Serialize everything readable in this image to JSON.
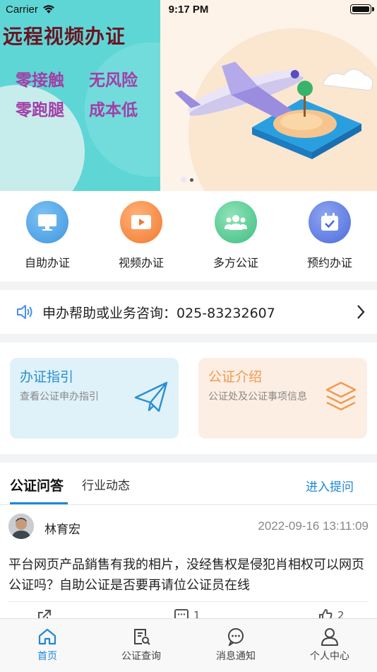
{
  "status_bar": {
    "carrier": "Carrier",
    "time": "9:17 PM"
  },
  "banner": {
    "title": "远程视频办证",
    "slogans": [
      "零接触",
      "无风险",
      "零跑腿",
      "成本低"
    ],
    "page_count": 2,
    "active_page": 1
  },
  "quick_actions": [
    {
      "label": "自助办证",
      "icon": "monitor-icon",
      "color": "#4aa3e8"
    },
    {
      "label": "视频办证",
      "icon": "video-camera-icon",
      "color": "#f58a3a"
    },
    {
      "label": "多方公证",
      "icon": "group-icon",
      "color": "#4cc98e"
    },
    {
      "label": "预约办证",
      "icon": "calendar-check-icon",
      "color": "#5a79e0"
    }
  ],
  "hotline": {
    "text": "申办帮助或业务咨询：025-83232607"
  },
  "cards": [
    {
      "title": "办证指引",
      "desc": "查看公证申办指引",
      "icon": "paper-plane-icon"
    },
    {
      "title": "公证介绍",
      "desc": "公证处及公证事项信息",
      "icon": "layers-icon"
    }
  ],
  "qa_tabs": {
    "active": "公证问答",
    "inactive": "行业动态",
    "ask_link": "进入提问"
  },
  "post": {
    "author": "林育宏",
    "time": "2022-09-16 13:11:09",
    "text": "平台网页产品銷售有我的相片，没经售权是侵犯肖相权可以网页公证吗？自助公证是否要再请位公证员在线",
    "comments": "1",
    "likes": "2"
  },
  "bottom_nav": [
    {
      "label": "首页",
      "icon": "home-icon",
      "active": true
    },
    {
      "label": "公证查询",
      "icon": "document-search-icon",
      "active": false
    },
    {
      "label": "消息通知",
      "icon": "chat-bubble-icon",
      "active": false
    },
    {
      "label": "个人中心",
      "icon": "user-icon",
      "active": false
    }
  ]
}
